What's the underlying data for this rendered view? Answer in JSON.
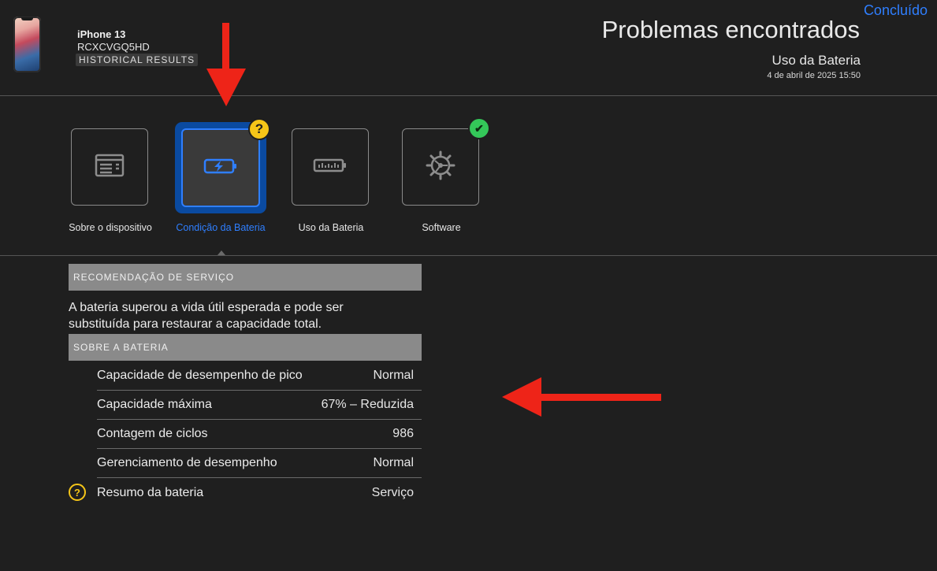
{
  "header": {
    "done_label": "Concluído",
    "title": "Problemas encontrados",
    "subtitle": "Uso da Bateria",
    "datetime": "4 de abril de 2025 15:50"
  },
  "device": {
    "name": "iPhone 13",
    "serial": "RCXCVGQ5HD",
    "badge": "HISTORICAL RESULTS"
  },
  "categories": [
    {
      "label": "Sobre o dispositivo",
      "icon": "device-info-icon",
      "status": "none",
      "selected": false
    },
    {
      "label": "Condição da Bateria",
      "icon": "battery-charging-icon",
      "status": "warning",
      "status_symbol": "?",
      "selected": true
    },
    {
      "label": "Uso da Bateria",
      "icon": "battery-usage-icon",
      "status": "none",
      "selected": false
    },
    {
      "label": "Software",
      "icon": "gear-icon",
      "status": "ok",
      "status_symbol": "✔",
      "selected": false
    }
  ],
  "recommendation": {
    "heading": "RECOMENDAÇÃO DE SERVIÇO",
    "text": "A bateria superou a vida útil esperada e pode ser substituída para restaurar a capacidade total."
  },
  "battery": {
    "heading": "SOBRE A BATERIA",
    "rows": [
      {
        "label": "Capacidade de desempenho de pico",
        "value": "Normal"
      },
      {
        "label": "Capacidade máxima",
        "value": "67% – Reduzida"
      },
      {
        "label": "Contagem de ciclos",
        "value": "986"
      },
      {
        "label": "Gerenciamento de desempenho",
        "value": "Normal"
      },
      {
        "label": "Resumo da bateria",
        "value": "Serviço",
        "status_symbol": "?"
      }
    ]
  },
  "colors": {
    "accent": "#2f7fff",
    "warning": "#f5c518",
    "ok": "#34c759",
    "annotation": "#ee2418",
    "background": "#1f1f1f"
  }
}
